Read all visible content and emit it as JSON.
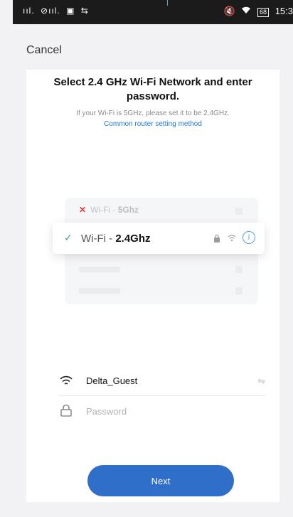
{
  "status_bar": {
    "left_indicators": [
      "ııl.",
      "⊘ııl.",
      "▣",
      "⇆"
    ],
    "right_icons": [
      "🔇",
      "wifi"
    ],
    "battery": "68",
    "time": "15:3"
  },
  "header": {
    "cancel_label": "Cancel"
  },
  "page": {
    "title": "Select 2.4 GHz Wi-Fi Network and enter password.",
    "hint": "If your Wi-Fi is 5GHz, please set it to be 2.4GHz.",
    "link": "Common router setting method"
  },
  "illustration": {
    "row_5g_prefix": "Wi-Fi - ",
    "row_5g_band": "5Ghz",
    "row_24_prefix": "Wi-Fi - ",
    "row_24_band": "2.4Ghz",
    "info_glyph": "i"
  },
  "form": {
    "ssid_value": "Delta_Guest",
    "password_placeholder": "Password"
  },
  "actions": {
    "next_label": "Next"
  },
  "colors": {
    "accent": "#2f6fc9",
    "link": "#1f7ae0",
    "check": "#36b36a",
    "error": "#e53b3b"
  }
}
